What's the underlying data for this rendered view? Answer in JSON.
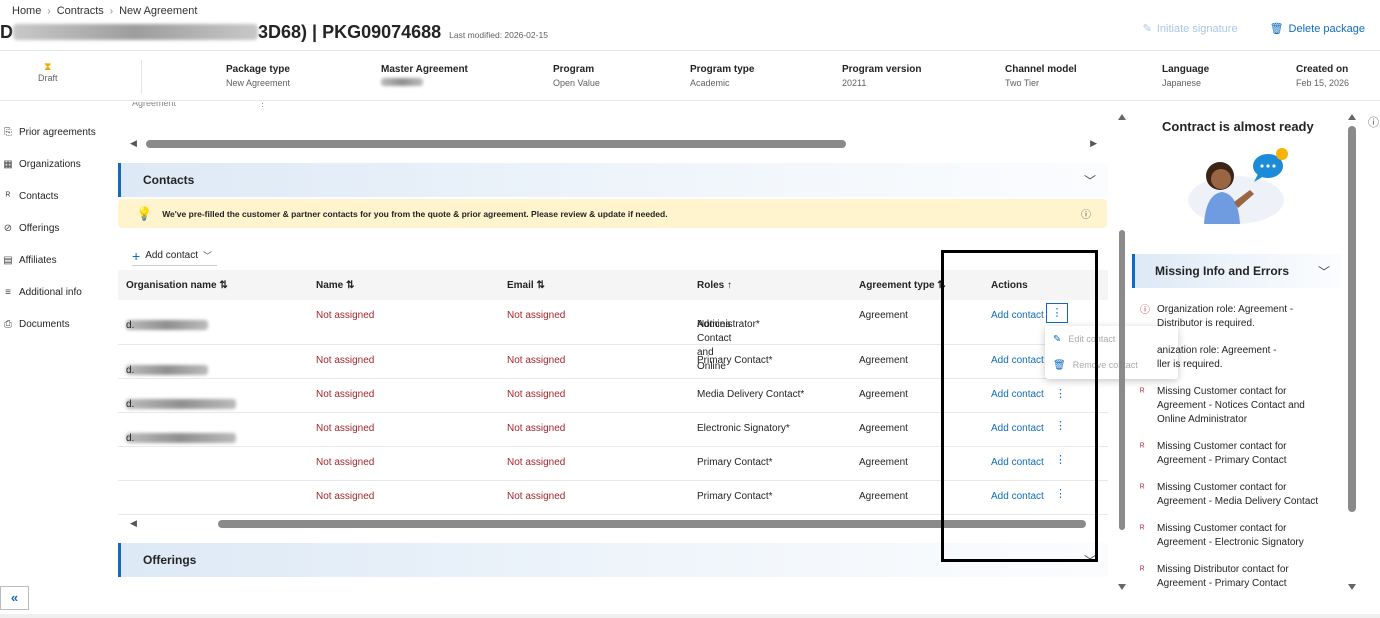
{
  "breadcrumb": [
    "Home",
    "Contracts",
    "New Agreement"
  ],
  "header": {
    "title_visible_start": "D",
    "title_visible_mid": "3D68) | PKG09074688",
    "last_modified": "Last modified: 2026-02-15",
    "initiate_signature": "Initiate signature",
    "delete_package": "Delete package"
  },
  "info": {
    "status": "Draft",
    "package_type_label": "Package type",
    "package_type": "New Agreement",
    "master_agreement_label": "Master Agreement",
    "program_label": "Program",
    "program": "Open Value",
    "program_type_label": "Program type",
    "program_type": "Academic",
    "program_version_label": "Program version",
    "program_version": "20211",
    "channel_model_label": "Channel model",
    "channel_model": "Two Tier",
    "language_label": "Language",
    "language": "Japanese",
    "created_on_label": "Created on",
    "created_on": "Feb 15, 2026"
  },
  "nav": [
    "Prior agreements",
    "Organizations",
    "Contacts",
    "Offerings",
    "Affiliates",
    "Additional info",
    "Documents"
  ],
  "contacts": {
    "section_title": "Contacts",
    "banner": "We've pre-filled the customer & partner contacts for you from the quote & prior agreement. Please review & update if needed.",
    "add_contact": "Add contact",
    "columns": [
      "Organisation name ⇅",
      "Name ⇅",
      "Email ⇅",
      "Roles ↑",
      "Agreement type ⇅",
      "Actions"
    ],
    "rows": [
      {
        "org_suffix": "d.",
        "name": "Not assigned",
        "email": "Not assigned",
        "role_line1": "Notices Contact and Online",
        "role_line2": "Administrator*",
        "type": "Agreement",
        "action": "Add contact"
      },
      {
        "org_suffix": "d.",
        "name": "Not assigned",
        "email": "Not assigned",
        "role_line1": "Primary Contact*",
        "role_line2": "",
        "type": "Agreement",
        "action": "Add contact"
      },
      {
        "org_suffix": "d.",
        "name": "Not assigned",
        "email": "Not assigned",
        "role_line1": "Media Delivery Contact*",
        "role_line2": "",
        "type": "Agreement",
        "action": "Add contact"
      },
      {
        "org_suffix": "d.",
        "name": "Not assigned",
        "email": "Not assigned",
        "role_line1": "Electronic Signatory*",
        "role_line2": "",
        "type": "Agreement",
        "action": "Add contact"
      },
      {
        "org_suffix": "",
        "name": "Not assigned",
        "email": "Not assigned",
        "role_line1": "Primary Contact*",
        "role_line2": "",
        "type": "Agreement",
        "action": "Add contact"
      },
      {
        "org_suffix": "",
        "name": "Not assigned",
        "email": "Not assigned",
        "role_line1": "Primary Contact*",
        "role_line2": "",
        "type": "Agreement",
        "action": "Add contact"
      }
    ]
  },
  "menu": {
    "edit": "Edit contact",
    "remove": "Remove contact"
  },
  "offerings_title": "Offerings",
  "right": {
    "ready_title": "Contract is almost ready",
    "missing_title": "Missing Info and Errors",
    "errors": [
      {
        "line1": "Organization role: Agreement -",
        "line2": "Distributor is required.",
        "line3": ""
      },
      {
        "line1": "anization role: Agreement -",
        "line2": "ller is required.",
        "line3": ""
      },
      {
        "line1": "Missing Customer contact for",
        "line2": "Agreement - Notices Contact and",
        "line3": "Online Administrator"
      },
      {
        "line1": "Missing Customer contact for",
        "line2": "Agreement - Primary Contact",
        "line3": ""
      },
      {
        "line1": "Missing Customer contact for",
        "line2": "Agreement - Media Delivery Contact",
        "line3": ""
      },
      {
        "line1": "Missing Customer contact for",
        "line2": "Agreement - Electronic Signatory",
        "line3": ""
      },
      {
        "line1": "Missing Distributor contact for",
        "line2": "Agreement - Primary Contact",
        "line3": ""
      }
    ]
  },
  "colors": {
    "accent": "#0f6cbd",
    "error": "#a4262c",
    "banner": "#fff4ce"
  }
}
